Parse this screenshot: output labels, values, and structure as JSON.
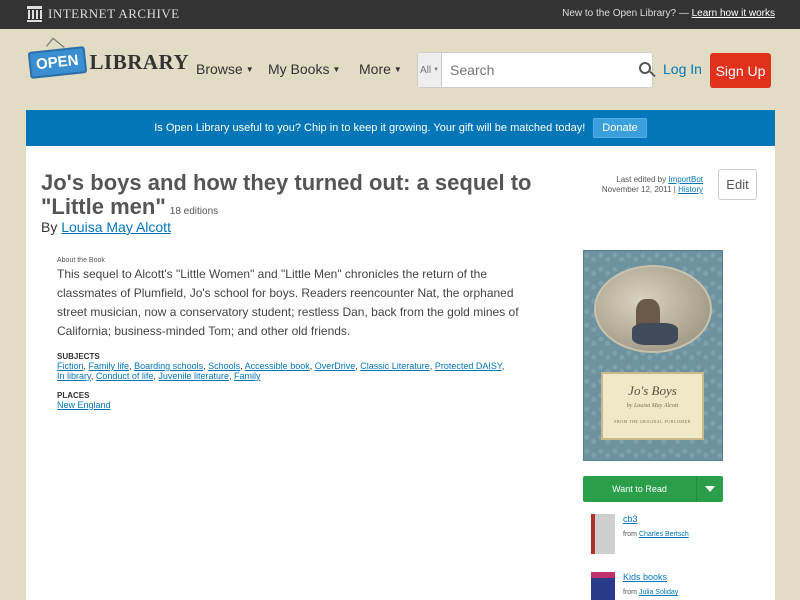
{
  "ia_bar": {
    "logo_text": "INTERNET ARCHIVE",
    "tagline": "New to the Open Library? —",
    "learn_link": "Learn how it works"
  },
  "header": {
    "logo_open": "OPEN",
    "logo_library": "LIBRARY",
    "nav": [
      {
        "label": "Browse"
      },
      {
        "label": "My Books"
      },
      {
        "label": "More"
      }
    ],
    "search": {
      "scope": "All",
      "placeholder": "Search"
    },
    "login_label": "Log In",
    "signup_label": "Sign Up"
  },
  "donate_banner": {
    "text": "Is Open Library useful to you? Chip in to keep it growing. Your gift will be matched today!",
    "button": "Donate"
  },
  "book": {
    "title": "Jo's boys and how they turned out: a sequel to \"Little men\"",
    "editions": "18 editions",
    "by_label": "By",
    "author": "Louisa May Alcott",
    "edited_label": "Last edited by",
    "edited_by": "ImportBot",
    "edited_date": "November 12, 2011 |",
    "history_link": "History",
    "edit_button": "Edit",
    "about_label": "About the Book",
    "description": "This sequel to Alcott's \"Little Women\" and \"Little Men\" chronicles the return of the classmates of Plumfield, Jo's school for boys. Readers reencounter Nat, the orphaned street musician, now a conservatory student; restless Dan, back from the gold mines of California; business-minded Tom; and other old friends.",
    "subjects_label": "SUBJECTS",
    "subjects": [
      "Fiction",
      "Family life",
      "Boarding schools",
      "Schools",
      "Accessible book",
      "OverDrive",
      "Classic Literature",
      "Protected DAISY",
      "In library",
      "Conduct of life",
      "Juvenile literature",
      "Family"
    ],
    "places_label": "PLACES",
    "places": [
      "New England"
    ]
  },
  "cover": {
    "title": "Jo's Boys",
    "author": "by Louisa May Alcott",
    "subtitle": "FROM THE ORIGINAL PUBLISHER"
  },
  "sidebar": {
    "want_to_read": "Want to Read",
    "lists": [
      {
        "name": "cb3",
        "from_label": "from",
        "from_user": "Charles Bertsch",
        "thumb_color": "#b03030"
      },
      {
        "name": "Kids books",
        "from_label": "from",
        "from_user": "Julia Soliday",
        "thumb_color": "#2a3a8a"
      }
    ]
  },
  "colors": {
    "accent_blue": "#0376b8",
    "signup_red": "#e1301c",
    "want_green": "#2b9e4a",
    "background": "#e2dcc5"
  }
}
